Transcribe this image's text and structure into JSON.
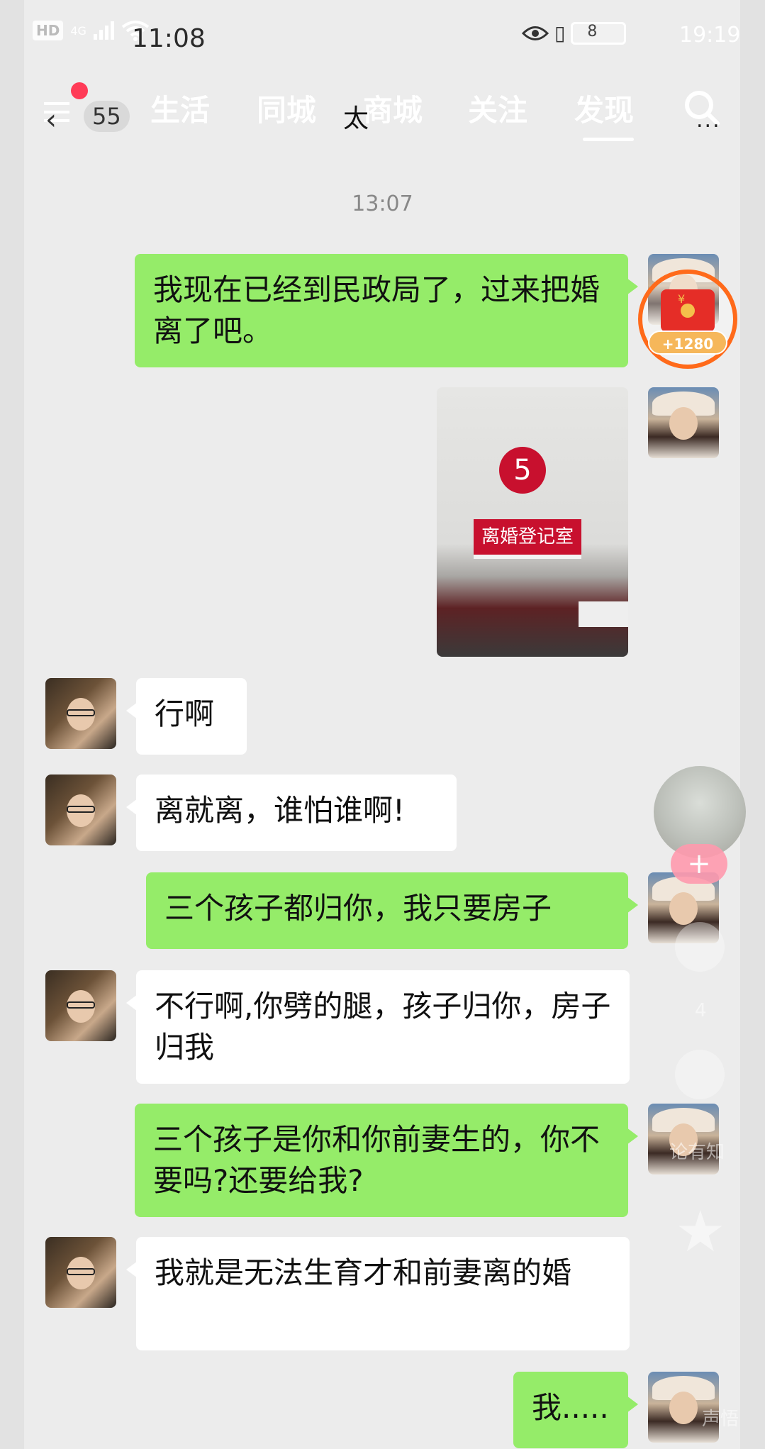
{
  "status_bar": {
    "hd": "HD",
    "network": "4G",
    "time": "11:08",
    "battery": "8",
    "time_overlay": "19:19"
  },
  "top_nav": {
    "back_count": "55",
    "chat_title": "太",
    "tabs": [
      "生活",
      "同城",
      "商城",
      "关注",
      "发现"
    ],
    "active_tab": "发现",
    "more": "..."
  },
  "chat": {
    "timestamp": "13:07",
    "messages": [
      {
        "from": "me",
        "text": "我现在已经到民政局了，过来把婚离了吧。"
      },
      {
        "from": "me",
        "type": "image",
        "badge_number": "5",
        "sign_text": "离婚登记室"
      },
      {
        "from": "them",
        "text": "行啊"
      },
      {
        "from": "them",
        "text": "离就离，谁怕谁啊!"
      },
      {
        "from": "me",
        "text": "三个孩子都归你，我只要房子"
      },
      {
        "from": "them",
        "text": "不行啊,你劈的腿，孩子归你，房子归我"
      },
      {
        "from": "me",
        "text": "三个孩子是你和你前妻生的，你不要吗?还要给我?"
      },
      {
        "from": "them",
        "text": "我就是无法生育才和前妻离的婚"
      },
      {
        "from": "me",
        "text": "我....."
      }
    ]
  },
  "overlay": {
    "red_packet": {
      "symbol": "¥",
      "amount": "+1280"
    },
    "follow_plus": "+",
    "ghost_count": "4",
    "ghost_label": "论有知",
    "ghost_bottom": "声悟"
  },
  "colors": {
    "bubble_me": "#95ec69",
    "bubble_them": "#ffffff",
    "background": "#ececec",
    "red_dot": "#ff3b57"
  }
}
